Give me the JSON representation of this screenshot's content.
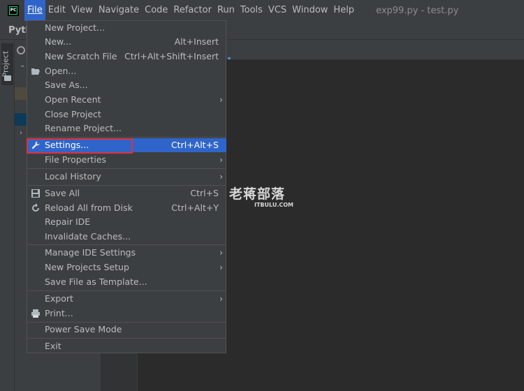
{
  "menubar": {
    "app_logo_text": "PC",
    "items": [
      "File",
      "Edit",
      "View",
      "Navigate",
      "Code",
      "Refactor",
      "Run",
      "Tools",
      "VCS",
      "Window",
      "Help"
    ],
    "window_title": "exp99.py - test.py"
  },
  "toolbar": {
    "project_crumb": "Pyth"
  },
  "sidebar": {
    "project_tab_label": "Project"
  },
  "watermark": {
    "main": "老蒋部落",
    "sub": "ITBULU.COM"
  },
  "file_menu": {
    "items": [
      {
        "label": "New Project...",
        "shortcut": "",
        "submenu": false,
        "icon": ""
      },
      {
        "label": "New...",
        "shortcut": "Alt+Insert",
        "submenu": false,
        "icon": ""
      },
      {
        "label": "New Scratch File",
        "shortcut": "Ctrl+Alt+Shift+Insert",
        "submenu": false,
        "icon": ""
      },
      {
        "label": "Open...",
        "shortcut": "",
        "submenu": false,
        "icon": "folder-open-icon"
      },
      {
        "label": "Save As...",
        "shortcut": "",
        "submenu": false,
        "icon": ""
      },
      {
        "label": "Open Recent",
        "shortcut": "",
        "submenu": true,
        "icon": ""
      },
      {
        "label": "Close Project",
        "shortcut": "",
        "submenu": false,
        "icon": ""
      },
      {
        "label": "Rename Project...",
        "shortcut": "",
        "submenu": false,
        "icon": ""
      },
      {
        "label": "Settings...",
        "shortcut": "Ctrl+Alt+S",
        "submenu": false,
        "icon": "wrench-icon",
        "selected": true
      },
      {
        "label": "File Properties",
        "shortcut": "",
        "submenu": true,
        "icon": ""
      },
      {
        "label": "Local History",
        "shortcut": "",
        "submenu": true,
        "icon": ""
      },
      {
        "label": "Save All",
        "shortcut": "Ctrl+S",
        "submenu": false,
        "icon": "save-icon"
      },
      {
        "label": "Reload All from Disk",
        "shortcut": "Ctrl+Alt+Y",
        "submenu": false,
        "icon": "reload-icon"
      },
      {
        "label": "Repair IDE",
        "shortcut": "",
        "submenu": false,
        "icon": ""
      },
      {
        "label": "Invalidate Caches...",
        "shortcut": "",
        "submenu": false,
        "icon": ""
      },
      {
        "label": "Manage IDE Settings",
        "shortcut": "",
        "submenu": true,
        "icon": ""
      },
      {
        "label": "New Projects Setup",
        "shortcut": "",
        "submenu": true,
        "icon": ""
      },
      {
        "label": "Save File as Template...",
        "shortcut": "",
        "submenu": false,
        "icon": ""
      },
      {
        "label": "Export",
        "shortcut": "",
        "submenu": true,
        "icon": ""
      },
      {
        "label": "Print...",
        "shortcut": "",
        "submenu": false,
        "icon": "printer-icon"
      },
      {
        "label": "Power Save Mode",
        "shortcut": "",
        "submenu": false,
        "icon": ""
      },
      {
        "label": "Exit",
        "shortcut": "",
        "submenu": false,
        "icon": ""
      }
    ]
  },
  "colors": {
    "menubar_bg": "#3c3f41",
    "selection": "#2f65ca",
    "highlight_border": "#e0313b",
    "editor_bg": "#2b2b2b"
  }
}
